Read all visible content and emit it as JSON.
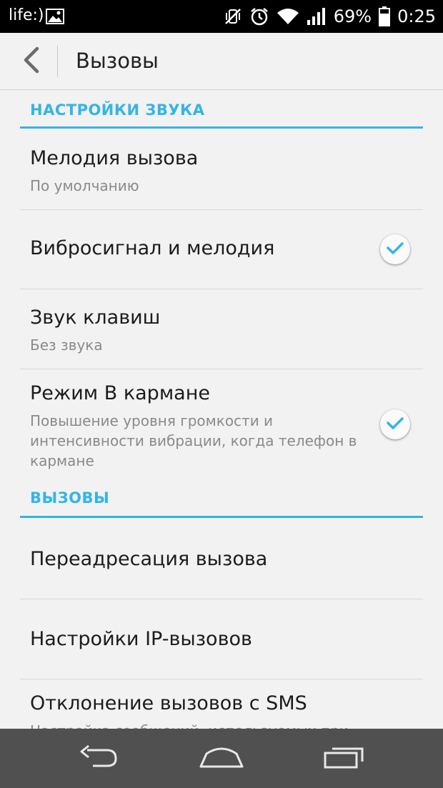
{
  "status_bar": {
    "carrier": "life:)",
    "battery": "69%",
    "time": "0:25"
  },
  "header": {
    "title": "Вызовы"
  },
  "sections": [
    {
      "title": "НАСТРОЙКИ ЗВУКА",
      "items": [
        {
          "title": "Мелодия вызова",
          "subtitle": "По умолчанию"
        },
        {
          "title": "Вибросигнал и мелодия",
          "checked": true
        },
        {
          "title": "Звук клавиш",
          "subtitle": "Без звука"
        },
        {
          "title": "Режим В кармане",
          "subtitle": "Повышение уровня громкости и интенсивности вибрации, когда телефон в кармане",
          "checked": true
        }
      ]
    },
    {
      "title": "ВЫЗОВЫ",
      "items": [
        {
          "title": "Переадресация вызова"
        },
        {
          "title": "Настройки IP-вызовов"
        },
        {
          "title": "Отклонение вызовов с SMS",
          "subtitle": "Настройка сообщений, используемых при"
        }
      ]
    }
  ],
  "colors": {
    "accent": "#33b5e5",
    "background": "#f2f2f2",
    "nav_bar": "#505050"
  },
  "icons": {
    "status": [
      "image-icon",
      "vibrate-off-icon",
      "alarm-icon",
      "wifi-icon",
      "signal-icon",
      "battery-icon"
    ],
    "nav": [
      "back-nav-icon",
      "home-nav-icon",
      "recents-nav-icon"
    ]
  }
}
